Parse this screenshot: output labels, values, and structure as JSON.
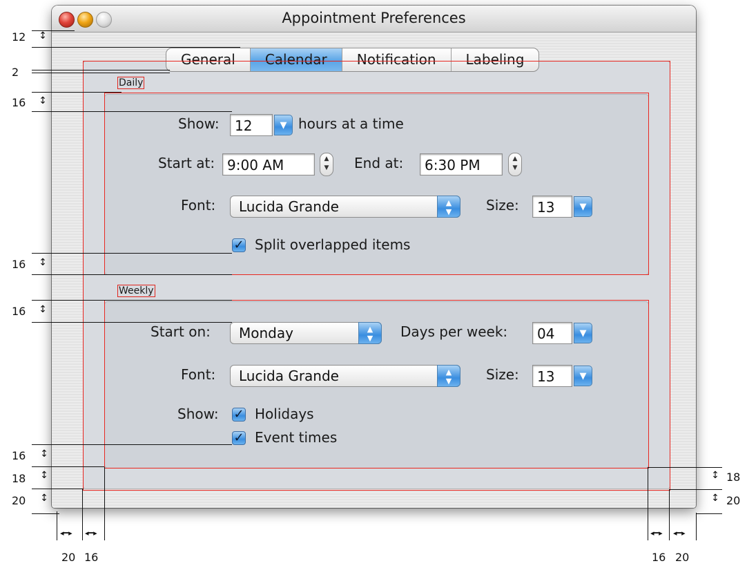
{
  "window": {
    "title": "Appointment Preferences"
  },
  "tabs": [
    {
      "label": "General",
      "selected": false
    },
    {
      "label": "Calendar",
      "selected": true
    },
    {
      "label": "Notification",
      "selected": false
    },
    {
      "label": "Labeling",
      "selected": false
    }
  ],
  "daily": {
    "section_label": "Daily",
    "show_label": "Show:",
    "show_value": "12",
    "show_suffix": "hours at a time",
    "start_label": "Start at:",
    "start_value": "9:00 AM",
    "end_label": "End at:",
    "end_value": "6:30 PM",
    "font_label": "Font:",
    "font_value": "Lucida Grande",
    "size_label": "Size:",
    "size_value": "13",
    "split_label": "Split overlapped items",
    "split_checked": true
  },
  "weekly": {
    "section_label": "Weekly",
    "start_label": "Start on:",
    "start_value": "Monday",
    "days_label": "Days per week:",
    "days_value": "04",
    "font_label": "Font:",
    "font_value": "Lucida Grande",
    "size_label": "Size:",
    "size_value": "13",
    "show_label": "Show:",
    "holidays_label": "Holidays",
    "holidays_checked": true,
    "event_times_label": "Event times",
    "event_times_checked": true
  },
  "annotations": {
    "left": [
      "12",
      "2",
      "16",
      "16",
      "16",
      "16",
      "18",
      "20"
    ],
    "bottom_left": [
      "20",
      "16"
    ],
    "bottom_right": [
      "16",
      "20"
    ],
    "right": [
      "18",
      "20"
    ]
  },
  "colors": {
    "accent_blue": "#3a8ee0",
    "guide_red": "#e8261f"
  }
}
